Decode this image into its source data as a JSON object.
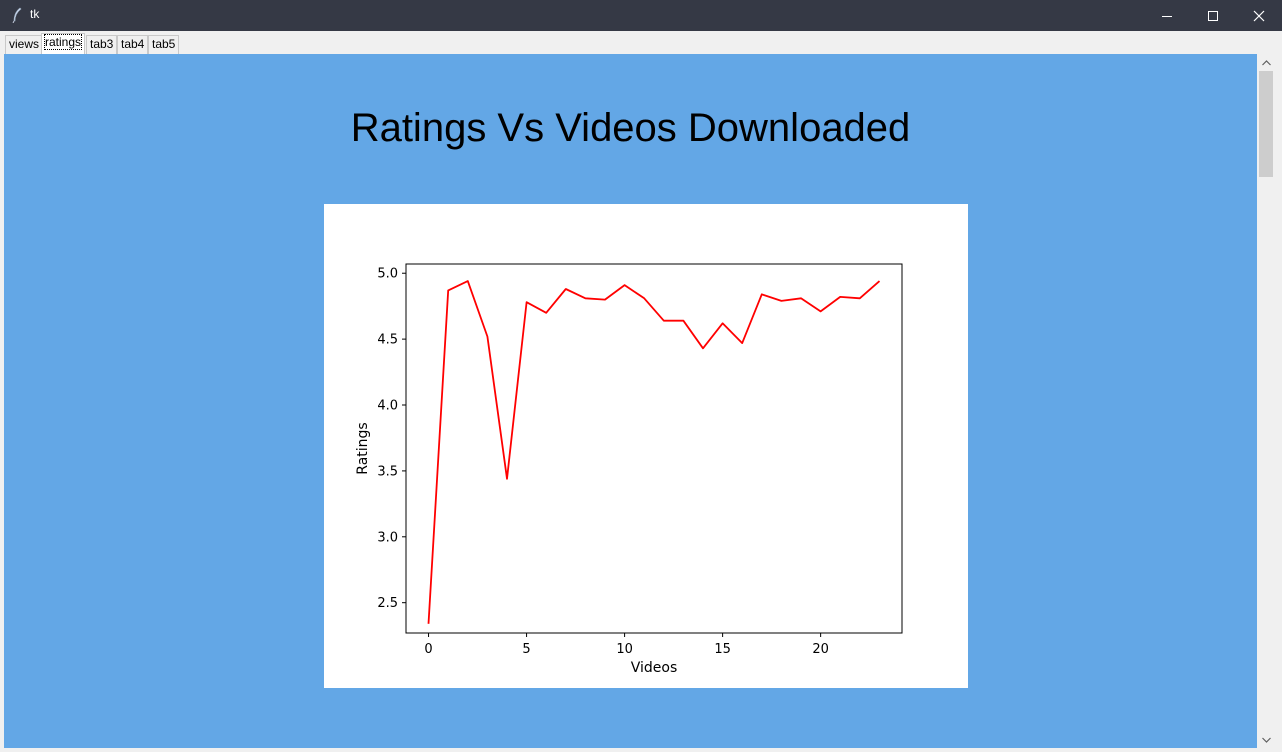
{
  "window": {
    "title": "tk",
    "icon": "feather-icon",
    "controls": [
      "minimize-icon",
      "maximize-icon",
      "close-icon"
    ]
  },
  "tabs": [
    {
      "label": "views",
      "active": false
    },
    {
      "label": "ratings",
      "active": true
    },
    {
      "label": "tab3",
      "active": false
    },
    {
      "label": "tab4",
      "active": false
    },
    {
      "label": "tab5",
      "active": false
    }
  ],
  "page": {
    "title": "Ratings Vs Videos Downloaded",
    "background": "#63a7e6"
  },
  "chart_data": {
    "type": "line",
    "title": "",
    "xlabel": "Videos",
    "ylabel": "Ratings",
    "xlim": [
      -1.15,
      24.15
    ],
    "ylim": [
      2.27,
      5.07
    ],
    "xticks": [
      0,
      5,
      10,
      15,
      20
    ],
    "yticks": [
      2.5,
      3.0,
      3.5,
      4.0,
      4.5,
      5.0
    ],
    "ytick_labels": [
      "2.5",
      "3.0",
      "3.5",
      "4.0",
      "4.5",
      "5.0"
    ],
    "grid": false,
    "series": [
      {
        "color": "#ff0000",
        "x": [
          0,
          1,
          2,
          3,
          4,
          5,
          6,
          7,
          8,
          9,
          10,
          11,
          12,
          13,
          14,
          15,
          16,
          17,
          18,
          19,
          20,
          21,
          22,
          23
        ],
        "y": [
          2.34,
          4.87,
          4.94,
          4.52,
          3.44,
          4.78,
          4.7,
          4.88,
          4.81,
          4.8,
          4.91,
          4.81,
          4.64,
          4.64,
          4.43,
          4.62,
          4.47,
          4.84,
          4.79,
          4.81,
          4.71,
          4.82,
          4.81,
          4.94
        ]
      }
    ]
  }
}
